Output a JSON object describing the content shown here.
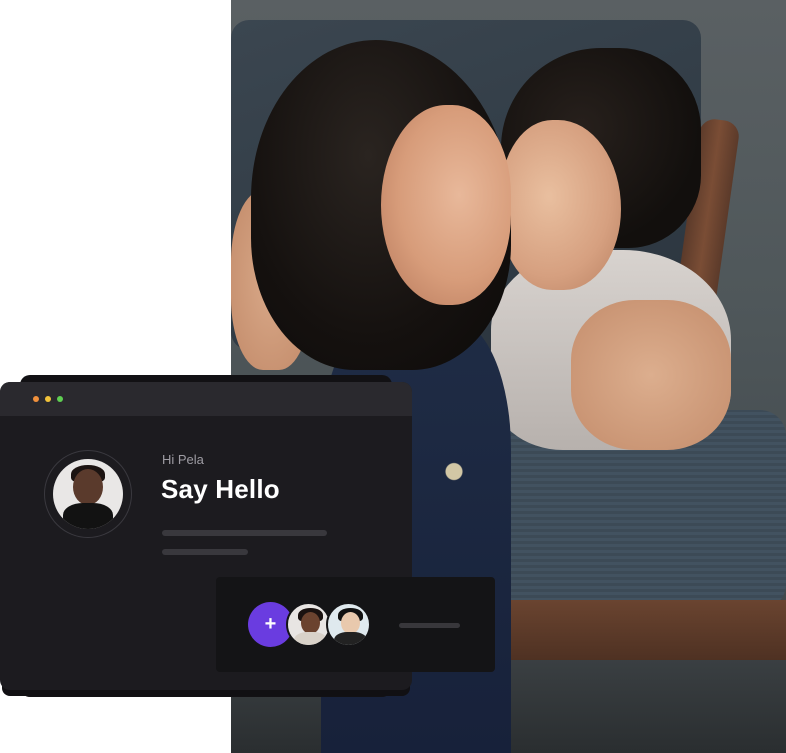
{
  "colors": {
    "window_bg": "#1c1b1f",
    "titlebar_bg": "#2a292e",
    "accent": "#6a3ce0",
    "dot_red": "#f0903c",
    "dot_yellow": "#f1c23a",
    "dot_green": "#5fcf52"
  },
  "photo": {
    "icon": "couple-photo"
  },
  "window": {
    "greeting": "Hi Pela",
    "headline": "Say Hello",
    "avatar_icon": "user-avatar"
  },
  "mini_card": {
    "add_label": "+",
    "avatars": [
      "avatar-woman",
      "avatar-man"
    ]
  }
}
